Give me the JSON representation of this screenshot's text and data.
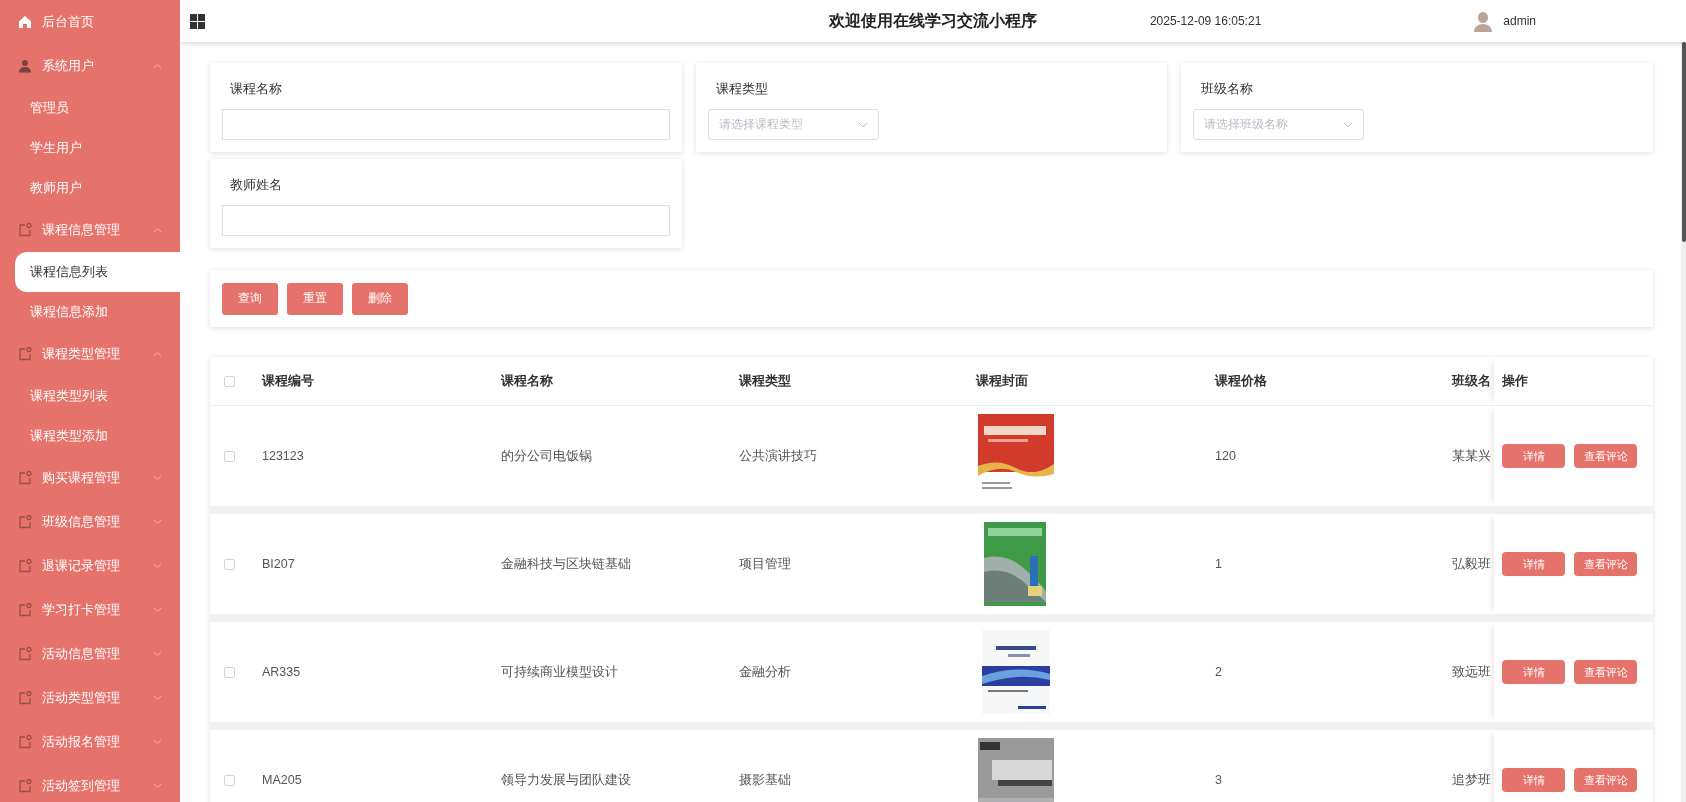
{
  "header": {
    "title": "欢迎使用在线学习交流小程序",
    "datetime": "2025-12-09 16:05:21",
    "user": "admin"
  },
  "sidebar": {
    "items": [
      {
        "label": "后台首页",
        "kind": "home"
      },
      {
        "label": "系统用户",
        "kind": "users",
        "expanded": true,
        "children": [
          {
            "label": "管理员",
            "selected": false
          },
          {
            "label": "学生用户",
            "selected": false
          },
          {
            "label": "教师用户",
            "selected": false
          }
        ]
      },
      {
        "label": "课程信息管理",
        "kind": "module",
        "expanded": true,
        "children": [
          {
            "label": "课程信息列表",
            "selected": true
          },
          {
            "label": "课程信息添加",
            "selected": false
          }
        ]
      },
      {
        "label": "课程类型管理",
        "kind": "module",
        "expanded": true,
        "children": [
          {
            "label": "课程类型列表",
            "selected": false
          },
          {
            "label": "课程类型添加",
            "selected": false
          }
        ]
      },
      {
        "label": "购买课程管理",
        "kind": "module",
        "expanded": false
      },
      {
        "label": "班级信息管理",
        "kind": "module",
        "expanded": false
      },
      {
        "label": "退课记录管理",
        "kind": "module",
        "expanded": false
      },
      {
        "label": "学习打卡管理",
        "kind": "module",
        "expanded": false
      },
      {
        "label": "活动信息管理",
        "kind": "module",
        "expanded": false
      },
      {
        "label": "活动类型管理",
        "kind": "module",
        "expanded": false
      },
      {
        "label": "活动报名管理",
        "kind": "module",
        "expanded": false
      },
      {
        "label": "活动签到管理",
        "kind": "module",
        "expanded": false
      }
    ]
  },
  "filters": [
    {
      "label": "课程名称",
      "kind": "text"
    },
    {
      "label": "课程类型",
      "kind": "select",
      "placeholder": "请选择课程类型"
    },
    {
      "label": "班级名称",
      "kind": "select",
      "placeholder": "请选择班级名称"
    },
    {
      "label": "教师姓名",
      "kind": "text"
    }
  ],
  "buttons": [
    "查询",
    "重置",
    "删除"
  ],
  "table": {
    "all_checked": false,
    "columns": [
      "课程编号",
      "课程名称",
      "课程类型",
      "课程封面",
      "课程价格",
      "班级名",
      "操作"
    ],
    "rows": [
      {
        "checked": false,
        "course_code": "123123",
        "course_name": "的分公司电饭锅",
        "course_type": "公共演讲技巧",
        "cover": {
          "kind": "picture"
        },
        "price": "120",
        "class_name": "某某兴",
        "actions": [
          "详情",
          "查看评论"
        ]
      },
      {
        "checked": false,
        "course_code": "BI207",
        "course_name": "金融科技与区块链基础",
        "course_type": "项目管理",
        "cover": {
          "kind": "picture"
        },
        "price": "1",
        "class_name": "弘毅班",
        "actions": [
          "详情",
          "查看评论"
        ]
      },
      {
        "checked": false,
        "course_code": "AR335",
        "course_name": "可持续商业模型设计",
        "course_type": "金融分析",
        "cover": {
          "kind": "picture"
        },
        "price": "2",
        "class_name": "致远班",
        "actions": [
          "详情",
          "查看评论"
        ]
      },
      {
        "checked": false,
        "course_code": "MA205",
        "course_name": "领导力发展与团队建设",
        "course_type": "摄影基础",
        "cover": {
          "kind": "picture"
        },
        "price": "3",
        "class_name": "追梦班",
        "actions": [
          "详情",
          "查看评论"
        ]
      }
    ]
  }
}
